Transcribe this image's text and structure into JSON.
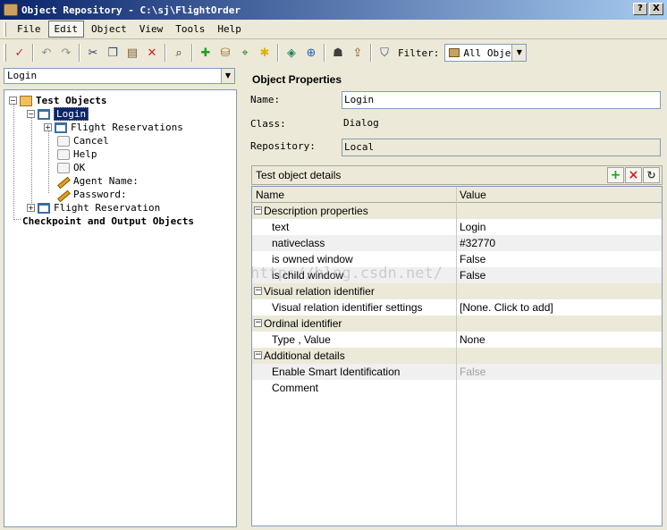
{
  "window": {
    "title": "Object Repository - C:\\sj\\FlightOrder",
    "help_button": "?",
    "close_button": "X"
  },
  "menu": {
    "items": [
      {
        "label": "File"
      },
      {
        "label": "Edit"
      },
      {
        "label": "Object"
      },
      {
        "label": "View"
      },
      {
        "label": "Tools"
      },
      {
        "label": "Help"
      }
    ]
  },
  "toolbar": {
    "icons": [
      "check-icon",
      "undo-icon",
      "redo-icon",
      "cut-icon",
      "copy-icon",
      "paste-icon",
      "delete-icon",
      "find-icon",
      "add-object-icon",
      "add-local-icon",
      "select-icon",
      "highlight-icon",
      "object-spy-icon",
      "navigate-icon",
      "incognito-icon",
      "export-icon"
    ],
    "filter_label": "Filter:",
    "filter_value": "All Obje"
  },
  "left": {
    "combo_value": "Login",
    "tree": {
      "root": "Test Objects",
      "login": "Login",
      "flight_reservations": "Flight Reservations",
      "cancel": "Cancel",
      "help": "Help",
      "ok": "OK",
      "agent_name": "Agent Name:",
      "password": "Password:",
      "flight_reservation": "Flight Reservation",
      "checkpoint": "Checkpoint and Output Objects"
    }
  },
  "properties": {
    "title": "Object Properties",
    "name_label": "Name:",
    "name_value": "Login",
    "class_label": "Class:",
    "class_value": "Dialog",
    "repository_label": "Repository:",
    "repository_value": "Local",
    "details_title": "Test object details",
    "grid": {
      "col_name": "Name",
      "col_value": "Value",
      "description_properties": "Description properties",
      "text_name": "text",
      "text_value": "Login",
      "nativeclass_name": "nativeclass",
      "nativeclass_value": "#32770",
      "owned_name": "is owned window",
      "owned_value": "False",
      "child_name": "is child window",
      "child_value": "False",
      "visual_relation": "Visual relation identifier",
      "vr_settings_name": "Visual relation identifier settings",
      "vr_settings_value": "[None. Click to add]",
      "ordinal": "Ordinal identifier",
      "type_value_name": "Type , Value",
      "type_value_value": "None",
      "additional": "Additional details",
      "smart_id_name": "Enable Smart Identification",
      "smart_id_value": "False",
      "comment_name": "Comment"
    }
  },
  "watermark": "http://blog.csdn.net/"
}
